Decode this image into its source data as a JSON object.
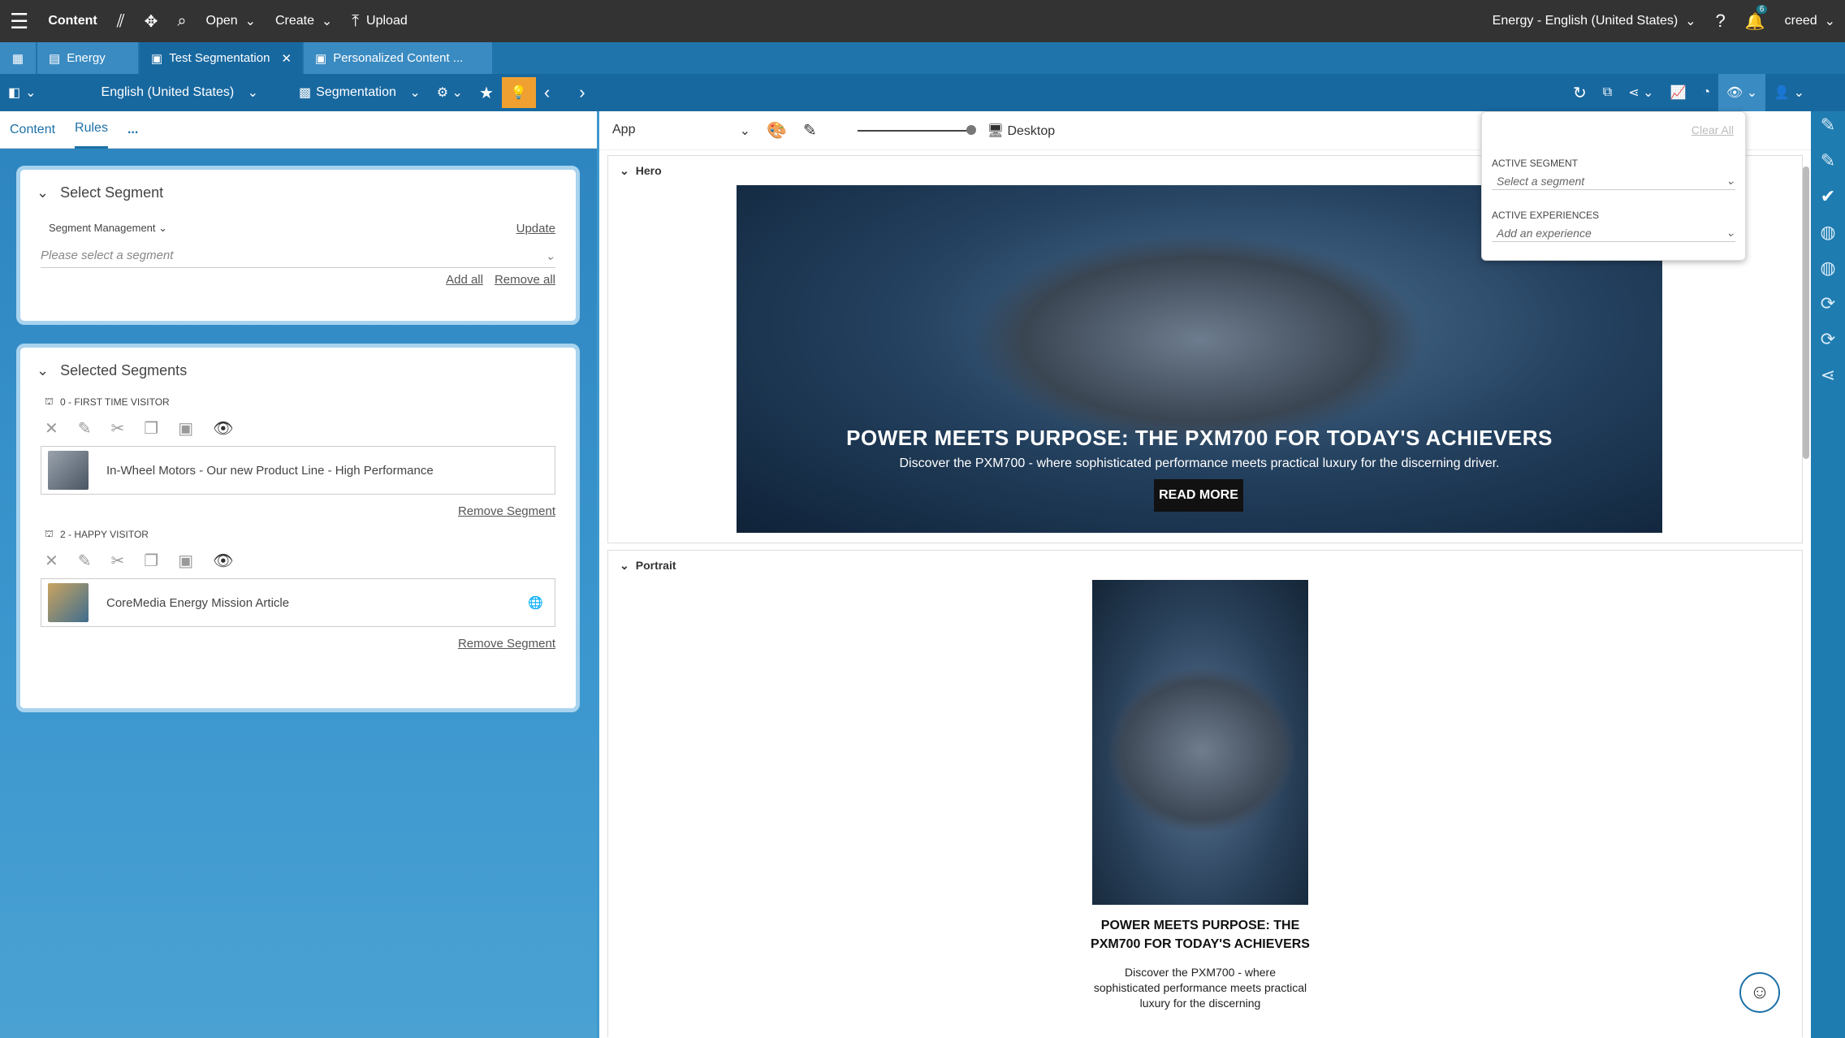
{
  "topbar": {
    "app_label": "Content",
    "open_label": "Open",
    "create_label": "Create",
    "upload_label": "Upload",
    "site_label": "Energy - English (United States)",
    "notification_count": "6",
    "user_label": "creed"
  },
  "tabs": [
    {
      "label": "Energy"
    },
    {
      "label": "Test Segmentation"
    },
    {
      "label": "Personalized Content ..."
    }
  ],
  "toolbar": {
    "locale_label": "English (United States)",
    "type_label": "Segmentation"
  },
  "left_panel": {
    "tabs": [
      "Content",
      "Rules",
      "..."
    ],
    "select_segment": {
      "title": "Select Segment",
      "source_label": "Segment Management",
      "update_link": "Update",
      "placeholder": "Please select a segment",
      "add_all": "Add all",
      "remove_all": "Remove all"
    },
    "selected_segments": {
      "title": "Selected Segments",
      "items": [
        {
          "label": "0 - FIRST TIME VISITOR",
          "content": "In-Wheel Motors - Our new Product Line - High Performance",
          "remove": "Remove Segment"
        },
        {
          "label": "2 - HAPPY VISITOR",
          "content": "CoreMedia Energy Mission Article",
          "remove": "Remove Segment"
        }
      ]
    }
  },
  "preview": {
    "app_label": "App",
    "device_label": "Desktop",
    "hero": {
      "section_label": "Hero",
      "title": "POWER MEETS PURPOSE: THE PXM700 FOR TODAY'S ACHIEVERS",
      "subtitle": "Discover the PXM700 - where sophisticated performance meets practical luxury for the discerning driver.",
      "button": "READ MORE"
    },
    "portrait": {
      "section_label": "Portrait",
      "title": "POWER MEETS PURPOSE: THE PXM700 FOR TODAY'S ACHIEVERS",
      "text": "Discover the PXM700 - where sophisticated performance meets practical luxury for the discerning"
    }
  },
  "popup": {
    "clear_all": "Clear All",
    "active_segment_label": "ACTIVE SEGMENT",
    "active_segment_placeholder": "Select a segment",
    "active_experiences_label": "ACTIVE EXPERIENCES",
    "active_experiences_placeholder": "Add an experience"
  }
}
